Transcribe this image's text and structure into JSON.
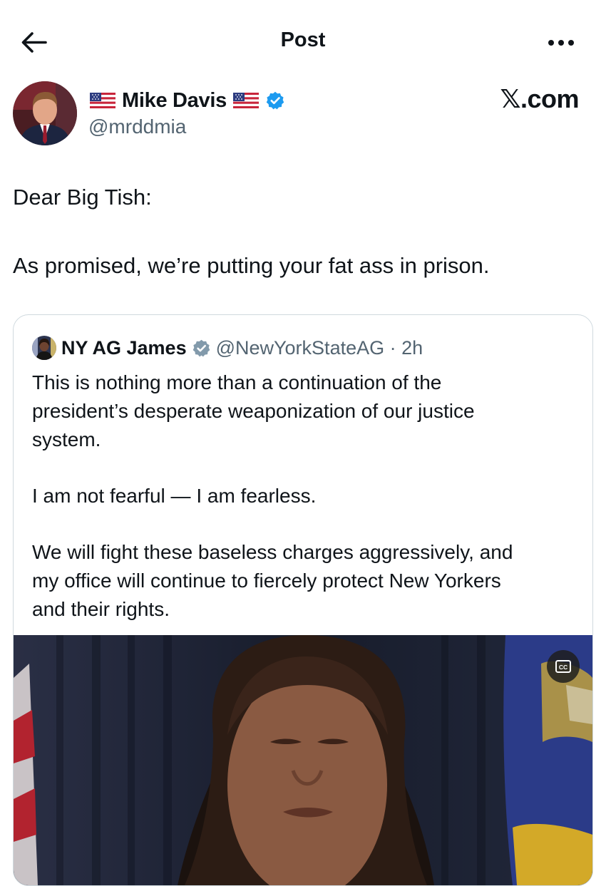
{
  "header": {
    "title": "Post",
    "back_icon": "arrow-left-icon",
    "more_icon": "more-horizontal-icon"
  },
  "author": {
    "name": "Mike Davis",
    "handle": "@mrddmia",
    "flag_icon": "us-flag-icon",
    "verified_icon": "verified-badge-icon",
    "verified_color": "#1d9bf0"
  },
  "source_label": "𝕏.com",
  "post": {
    "lines": [
      "Dear Big Tish:",
      "As promised, we’re putting your fat ass in prison."
    ]
  },
  "quoted_post": {
    "name": "NY AG James",
    "badge_icon": "government-badge-icon",
    "badge_color": "#829aab",
    "handle_time": "@NewYorkStateAG · 2h",
    "lines": [
      "This is nothing more than a continuation of the",
      "president’s desperate weaponization of our justice",
      "system.",
      "I am not fearful — I am fearless.",
      "We will fight these baseless charges aggressively, and",
      "my office will continue to fiercely protect New Yorkers",
      "and their rights."
    ],
    "media": {
      "type": "video",
      "captions_icon": "closed-captions-icon",
      "captions_label": "CC"
    }
  },
  "colors": {
    "text": "#0f1419",
    "secondary": "#536471",
    "border": "#cfd9de"
  }
}
